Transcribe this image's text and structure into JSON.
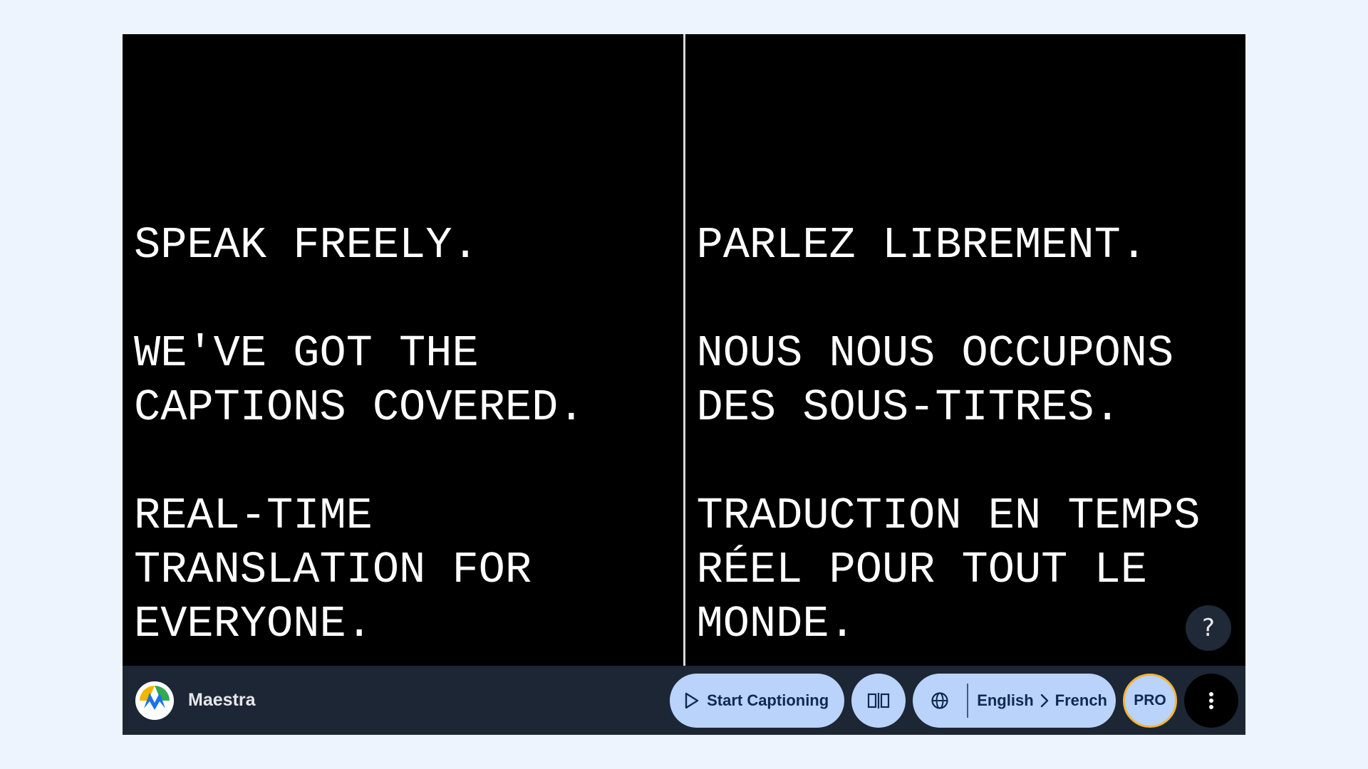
{
  "captions": {
    "source": {
      "paragraphs": [
        [
          "SPEAK FREELY."
        ],
        [
          "WE'VE GOT THE",
          "CAPTIONS COVERED."
        ],
        [
          "REAL-TIME",
          "TRANSLATION FOR",
          "EVERYONE."
        ]
      ]
    },
    "translation": {
      "paragraphs": [
        [
          "PARLEZ LIBREMENT."
        ],
        [
          "NOUS NOUS OCCUPONS",
          "DES SOUS-TITRES."
        ],
        [
          "TRADUCTION EN TEMPS",
          "RÉEL POUR TOUT LE",
          "MONDE."
        ]
      ]
    }
  },
  "help": {
    "label": "?"
  },
  "toolbar": {
    "brand_name": "Maestra",
    "start_label": "Start Captioning",
    "split_icon": "split-view-icon",
    "globe_icon": "globe-icon",
    "source_language": "English",
    "target_language": "French",
    "pro_label": "PRO",
    "more_icon": "more-vertical-icon"
  },
  "colors": {
    "page_bg": "#eef4fe",
    "caption_bg": "#000000",
    "caption_text": "#ffffff",
    "toolbar_bg": "#1d2634",
    "pill_bg": "#b9d3fb",
    "pill_text": "#0f2a52",
    "pro_border": "#f2b53c"
  }
}
